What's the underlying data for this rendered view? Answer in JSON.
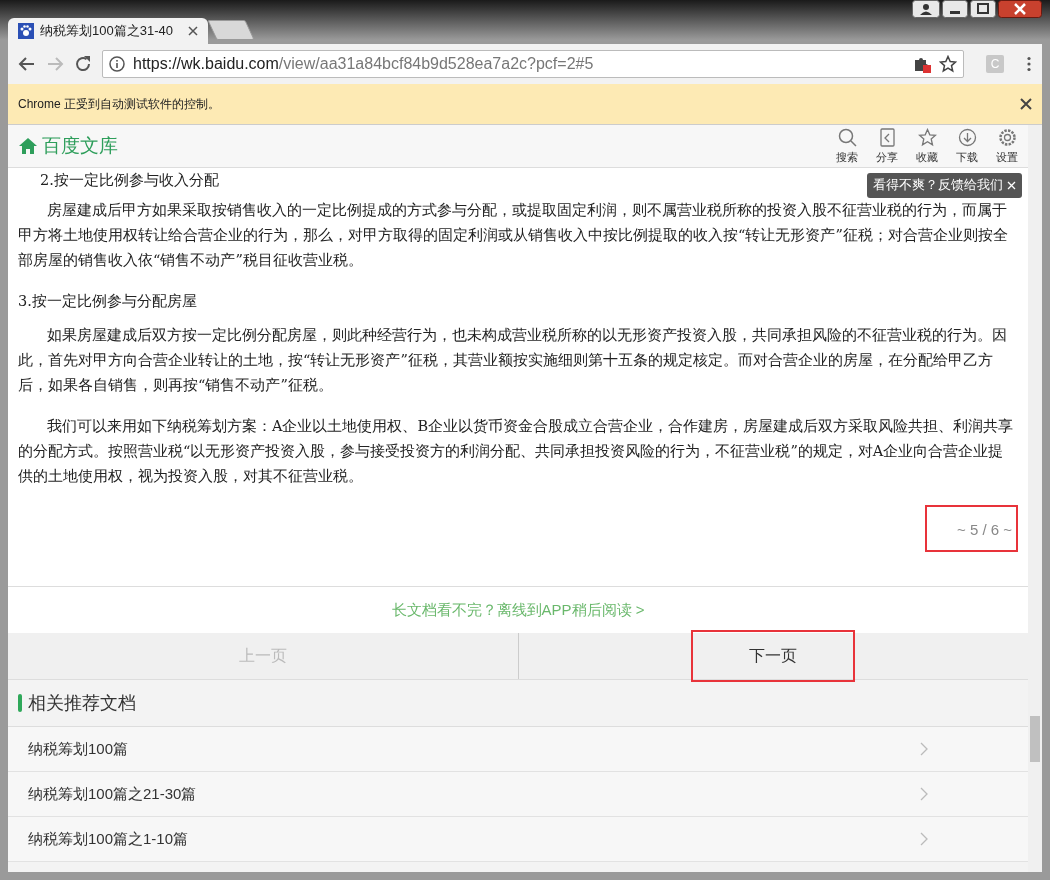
{
  "browser": {
    "tab_title": "纳税筹划100篇之31-40",
    "url_host": "https://wk.baidu.com",
    "url_path": "/view/aa31a84bcf84b9d528ea7a2c?pcf=2#5",
    "profile_letter": "C"
  },
  "infobar": {
    "text": "Chrome 正受到自动测试软件的控制。"
  },
  "site": {
    "logo": "百度文库",
    "tools": [
      {
        "kind": "search",
        "label": "搜索"
      },
      {
        "kind": "share",
        "label": "分享"
      },
      {
        "kind": "star",
        "label": "收藏"
      },
      {
        "kind": "download",
        "label": "下载"
      },
      {
        "kind": "settings",
        "label": "设置"
      }
    ],
    "tooltip": "看得不爽？反馈给我们"
  },
  "document": {
    "blocks": [
      {
        "kind": "heading",
        "text": "2.按一定比例参与收入分配"
      },
      {
        "kind": "paragraph",
        "text": "房屋建成后甲方如果采取按销售收入的一定比例提成的方式参与分配，或提取固定利润，则不属营业税所称的投资入股不征营业税的行为，而属于甲方将土地使用权转让给合营企业的行为，那么，对甲方取得的固定利润或从销售收入中按比例提取的收入按“转让无形资产”征税；对合营企业则按全部房屋的销售收入依“销售不动产”税目征收营业税。"
      },
      {
        "kind": "heading",
        "text": "3.按一定比例参与分配房屋"
      },
      {
        "kind": "paragraph",
        "text": "如果房屋建成后双方按一定比例分配房屋，则此种经营行为，也未构成营业税所称的以无形资产投资入股，共同承担风险的不征营业税的行为。因此，首先对甲方向合营企业转让的土地，按“转让无形资产”征税，其营业额按实施细则第十五条的规定核定。而对合营企业的房屋，在分配给甲乙方后，如果各自销售，则再按“销售不动产”征税。"
      },
      {
        "kind": "paragraph",
        "text": "我们可以来用如下纳税筹划方案：A企业以土地使用权、B企业以货币资金合股成立合营企业，合作建房，房屋建成后双方采取风险共担、利润共享的分配方式。按照营业税“以无形资产投资入股，参与接受投资方的利润分配、共同承担投资风险的行为，不征营业税”的规定，对A企业向合营企业提供的土地使用权，视为投资入股，对其不征营业税。"
      }
    ],
    "page_indicator": {
      "text": "~ 5 / 6 ~",
      "highlighted": true
    }
  },
  "app_promo": "长文档看不完？离线到APP稍后阅读 >",
  "pager": [
    {
      "label": "上一页",
      "disabled": true,
      "highlighted": false
    },
    {
      "label": "下一页",
      "disabled": false,
      "highlighted": true
    }
  ],
  "related": {
    "title": "相关推荐文档",
    "items": [
      {
        "title": "纳税筹划100篇"
      },
      {
        "title": "纳税筹划100篇之21-30篇"
      },
      {
        "title": "纳税筹划100篇之1-10篇"
      }
    ]
  }
}
